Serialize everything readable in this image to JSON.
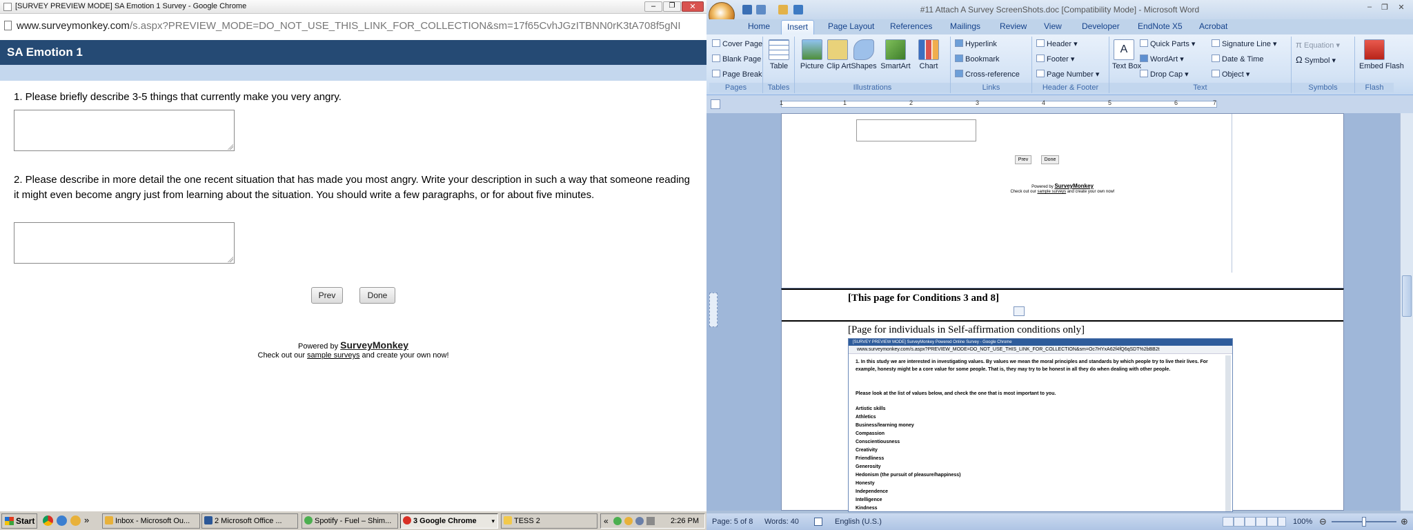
{
  "chrome": {
    "window_title": "[SURVEY PREVIEW MODE] SA Emotion 1 Survey - Google Chrome",
    "url_domain": "www.surveymonkey.com",
    "url_path": "/s.aspx?PREVIEW_MODE=DO_NOT_USE_THIS_LINK_FOR_COLLECTION&sm=17f65CvhJGzITBNN0rK3tA708f5gNI",
    "survey_title": "SA Emotion 1",
    "questions": [
      {
        "text": "1. Please briefly describe 3-5 things that currently make you very angry."
      },
      {
        "text": "2. Please describe in more detail the one recent situation that has made you most angry. Write your description in such a way that someone reading it might even become angry just from learning about the situation. You should write a few paragraphs, or for about five minutes."
      }
    ],
    "prev_label": "Prev",
    "done_label": "Done",
    "powered_by": "Powered by",
    "brand": "SurveyMonkey",
    "check_out": "Check out our",
    "sample_surveys": "sample surveys",
    "create_own": "and create your own now!"
  },
  "word": {
    "window_title": "#11 Attach A Survey ScreenShots.doc [Compatibility Mode] - Microsoft Word",
    "tabs": [
      "Home",
      "Insert",
      "Page Layout",
      "References",
      "Mailings",
      "Review",
      "View",
      "Developer",
      "EndNote X5",
      "Acrobat"
    ],
    "active_tab": "Insert",
    "ribbon": {
      "pages": {
        "label": "Pages",
        "items": [
          "Cover Page",
          "Blank Page",
          "Page Break"
        ]
      },
      "tables": {
        "label": "Tables",
        "items": [
          "Table"
        ]
      },
      "illustrations": {
        "label": "Illustrations",
        "items": [
          "Picture",
          "Clip Art",
          "Shapes",
          "SmartArt",
          "Chart"
        ]
      },
      "links": {
        "label": "Links",
        "items": [
          "Hyperlink",
          "Bookmark",
          "Cross-reference"
        ]
      },
      "header_footer": {
        "label": "Header & Footer",
        "items": [
          "Header",
          "Footer",
          "Page Number"
        ]
      },
      "text": {
        "label": "Text",
        "items": [
          "Text Box",
          "Quick Parts",
          "WordArt",
          "Drop Cap",
          "Signature Line",
          "Date & Time",
          "Object"
        ]
      },
      "symbols": {
        "label": "Symbols",
        "items": [
          "Equation",
          "Symbol"
        ]
      },
      "flash": {
        "label": "Flash",
        "items": [
          "Embed Flash"
        ]
      }
    },
    "ruler_numbers": [
      "1",
      "1",
      "2",
      "3",
      "4",
      "5",
      "6",
      "7"
    ],
    "doc": {
      "prev_label": "Prev",
      "done_label": "Done",
      "powered_by": "Powered by",
      "brand": "SurveyMonkey",
      "check_out": "Check out our",
      "sample_surveys": "sample surveys",
      "create_own": "and create your own now!",
      "heading_conditions": "[This page for Conditions 3 and 8]",
      "heading_self_affirmation": "[Page for individuals in Self-affirmation conditions only]",
      "embedded_title": "[SURVEY PREVIEW MODE] SurveyMonkey Powered Online Survey - Google Chrome",
      "embedded_url": "www.surveymonkey.com/s.aspx?PREVIEW_MODE=DO_NOT_USE_THIS_LINK_FOR_COLLECTION&sm=Oc7HYxA62f4fQ6qSDT%2bBB2t",
      "embedded_question": "1. In this study we are interested in investigating values. By values we mean the moral principles and standards by which people try to live their lives. For example, honesty might be a core value for some people. That is, they may try to be honest in all they do when dealing with other people.",
      "embedded_instruction": "Please look at the list of values below, and check the one that is most important to you.",
      "values": [
        "Artistic skills",
        "Athletics",
        "Business/learning money",
        "Compassion",
        "Conscientiousness",
        "Creativity",
        "Friendliness",
        "Generosity",
        "Hedonism (the pursuit of pleasure/happiness)",
        "Honesty",
        "Independence",
        "Intelligence",
        "Kindness"
      ]
    },
    "status": {
      "page": "Page: 5 of 8",
      "words": "Words: 40",
      "language": "English (U.S.)",
      "zoom": "100%"
    }
  },
  "taskbar": {
    "start": "Start",
    "buttons": [
      {
        "label": "Inbox - Microsoft Ou...",
        "color": "#e8b13a"
      },
      {
        "label": "2 Microsoft Office ...",
        "color": "#2b5797"
      },
      {
        "label": "Spotify - Fuel – Shim...",
        "color": "#4caf50"
      },
      {
        "label": "3 Google Chrome",
        "color": "#d93025"
      },
      {
        "label": "TESS 2",
        "color": "#f2c94c"
      }
    ],
    "clock": "2:26 PM",
    "overflow": "»"
  },
  "colors": {
    "survey_header": "#254a74",
    "survey_subbar": "#c4d7ee",
    "word_ribbon": "#d4e3f5"
  }
}
